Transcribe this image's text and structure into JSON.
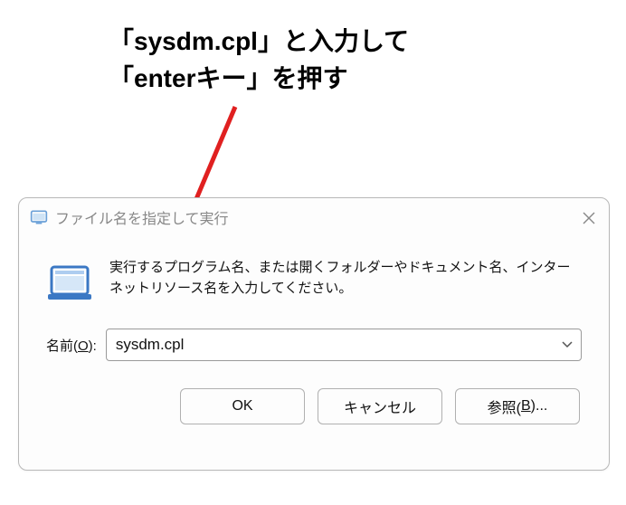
{
  "annotation": {
    "line1": "「sysdm.cpl」と入力して",
    "line2": "「enterキー」を押す"
  },
  "dialog": {
    "title": "ファイル名を指定して実行",
    "instruction": "実行するプログラム名、または開くフォルダーやドキュメント名、インターネットリソース名を入力してください。",
    "name_label": "名前(O):",
    "name_value": "sysdm.cpl",
    "buttons": {
      "ok": "OK",
      "cancel": "キャンセル",
      "browse": "参照(B)..."
    }
  },
  "colors": {
    "arrow": "#e02020"
  }
}
